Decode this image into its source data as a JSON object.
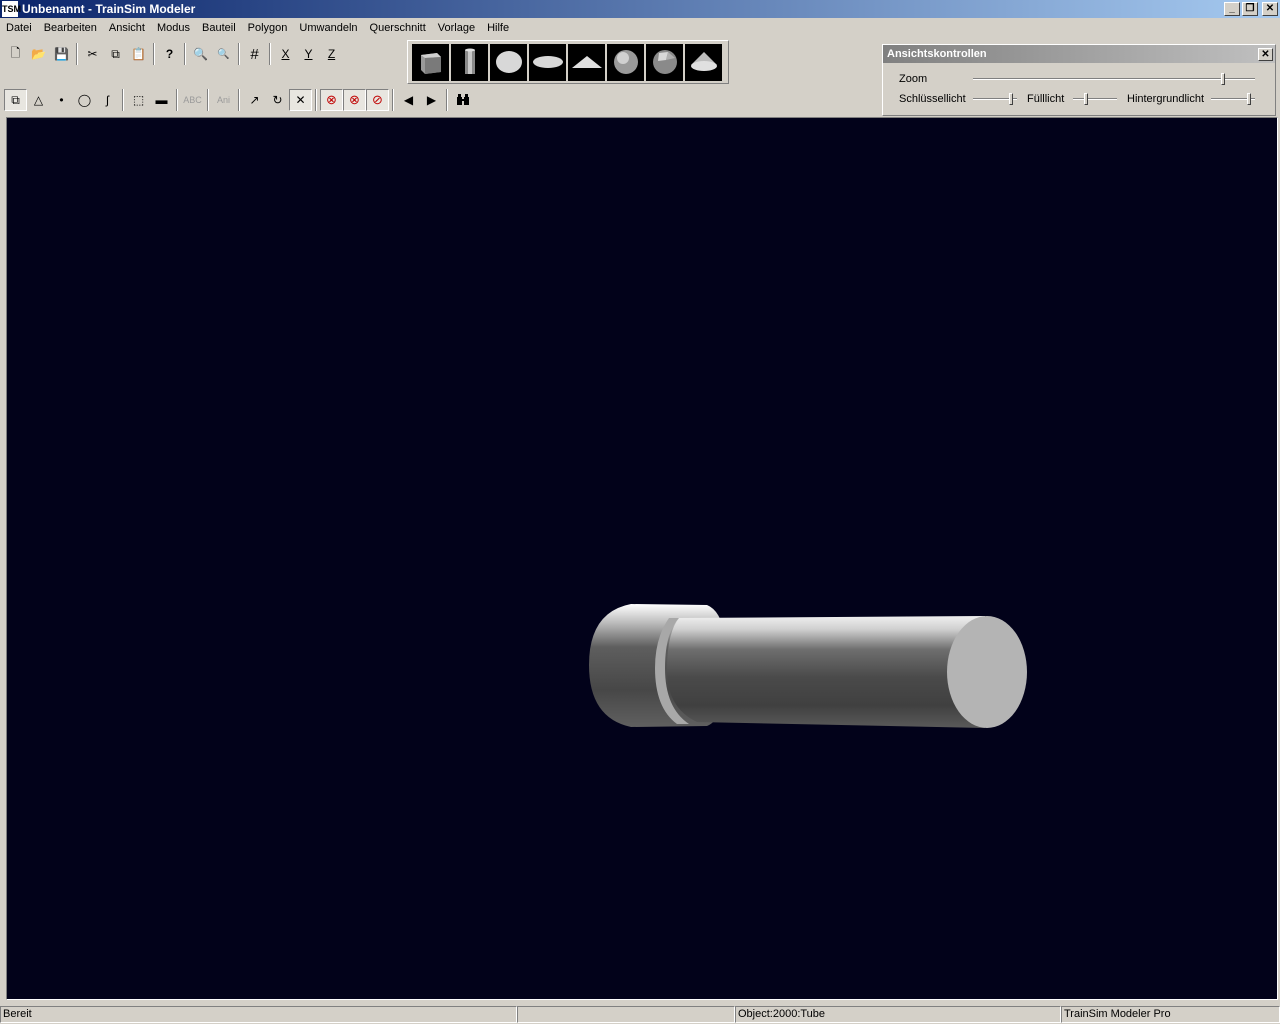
{
  "window": {
    "icon": "TSM",
    "title": "Unbenannt - TrainSim Modeler",
    "minimize": "_",
    "restore": "❐",
    "close": "✕"
  },
  "menu": [
    "Datei",
    "Bearbeiten",
    "Ansicht",
    "Modus",
    "Bauteil",
    "Polygon",
    "Umwandeln",
    "Querschnitt",
    "Vorlage",
    "Hilfe"
  ],
  "toolbar1": {
    "new": "🗋",
    "open": "📂",
    "save": "💾",
    "cut": "✂",
    "copy": "⧉",
    "paste": "📋",
    "help": "?",
    "zoom_in": "🔍",
    "zoom_out": "🔍",
    "grid": "#",
    "flip_x": "X",
    "flip_y": "Y",
    "flip_z": "Z"
  },
  "toolbar2": {
    "select_part": "⧉",
    "select_polygon": "△",
    "select_point": "•",
    "circle": "◯",
    "curve": "ʃ",
    "rect_select": "⬚",
    "ruler": "▬",
    "label_disabled": "ABC",
    "ani": "Ani",
    "rotate": "↗",
    "refresh": "↻",
    "scale": "✕",
    "no_move": "⊗",
    "no_rotate": "⊗",
    "no_scale": "⊘",
    "prev": "◀",
    "next": "▶",
    "binoculars": "⛓"
  },
  "primitives": [
    "cube",
    "cylinder",
    "disc",
    "ellipse",
    "pyramid",
    "sphere",
    "geosphere",
    "cone"
  ],
  "view_controls": {
    "title": "Ansichtskontrollen",
    "close": "✕",
    "zoom_label": "Zoom",
    "zoom_value": 0.9,
    "key_light_label": "Schlüssellicht",
    "key_light_value": 0.95,
    "fill_light_label": "Fülllicht",
    "fill_light_value": 0.3,
    "back_light_label": "Hintergrundlicht",
    "back_light_value": 0.95
  },
  "viewport": {
    "background": "#02021a",
    "object": "tube"
  },
  "status": {
    "state": "Bereit",
    "empty": "",
    "object": "Object:2000:Tube",
    "product": "TrainSim Modeler Pro"
  }
}
